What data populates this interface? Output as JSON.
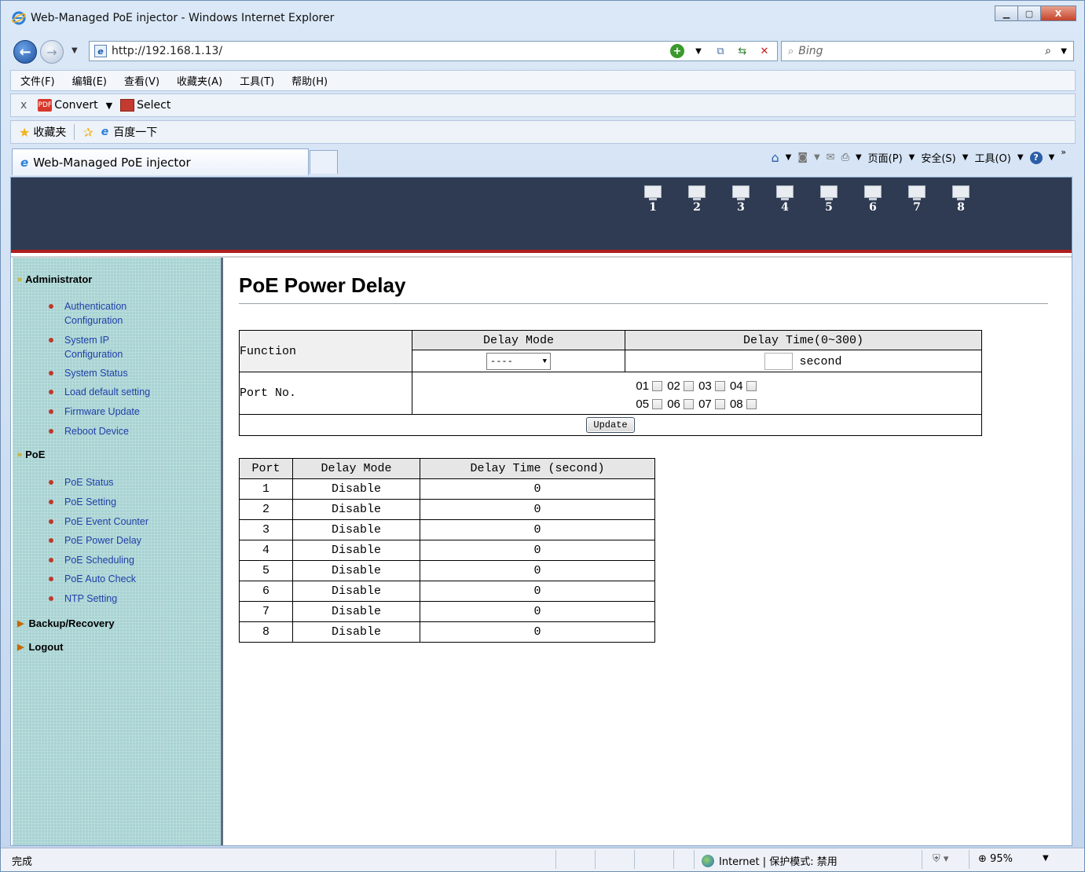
{
  "window": {
    "title": "Web-Managed PoE injector - Windows Internet Explorer",
    "min": "▁",
    "max": "▢",
    "close": "X"
  },
  "address": {
    "url": "http://192.168.1.13/",
    "search_placeholder": "Bing"
  },
  "menu": [
    "文件(F)",
    "编辑(E)",
    "查看(V)",
    "收藏夹(A)",
    "工具(T)",
    "帮助(H)"
  ],
  "convert_bar": {
    "close": "x",
    "convert": "Convert",
    "select": "Select"
  },
  "favorites_bar": {
    "favorites": "收藏夹",
    "link": "百度一下"
  },
  "tab": {
    "title": "Web-Managed PoE injector"
  },
  "command_bar": {
    "page": "页面(P)",
    "safety": "安全(S)",
    "tools": "工具(O)"
  },
  "header": {
    "ports": [
      "1",
      "2",
      "3",
      "4",
      "5",
      "6",
      "7",
      "8"
    ]
  },
  "sidebar": {
    "administrator": "Administrator",
    "admin_items": [
      "Authentication\nConfiguration",
      "System IP\nConfiguration",
      "System Status",
      "Load default setting",
      "Firmware Update",
      "Reboot Device"
    ],
    "poe": "PoE",
    "poe_items": [
      "PoE Status",
      "PoE Setting",
      "PoE Event Counter",
      "PoE Power Delay",
      "PoE Scheduling",
      "PoE Auto Check",
      "NTP Setting"
    ],
    "backup": "Backup/Recovery",
    "logout": "Logout"
  },
  "main": {
    "title": "PoE Power Delay",
    "form": {
      "function_label": "Function",
      "delay_mode_header": "Delay Mode",
      "delay_time_header": "Delay Time(0~300)",
      "delay_mode_value": "----",
      "delay_time_unit": "second",
      "port_no_label": "Port No.",
      "ports_row1": [
        "01",
        "02",
        "03",
        "04"
      ],
      "ports_row2": [
        "05",
        "06",
        "07",
        "08"
      ],
      "update_button": "Update"
    },
    "table": {
      "headers": [
        "Port",
        "Delay Mode",
        "Delay Time (second)"
      ],
      "rows": [
        [
          "1",
          "Disable",
          "0"
        ],
        [
          "2",
          "Disable",
          "0"
        ],
        [
          "3",
          "Disable",
          "0"
        ],
        [
          "4",
          "Disable",
          "0"
        ],
        [
          "5",
          "Disable",
          "0"
        ],
        [
          "6",
          "Disable",
          "0"
        ],
        [
          "7",
          "Disable",
          "0"
        ],
        [
          "8",
          "Disable",
          "0"
        ]
      ]
    }
  },
  "statusbar": {
    "done": "完成",
    "zone": "Internet | 保护模式: 禁用",
    "zoom": "95%"
  }
}
